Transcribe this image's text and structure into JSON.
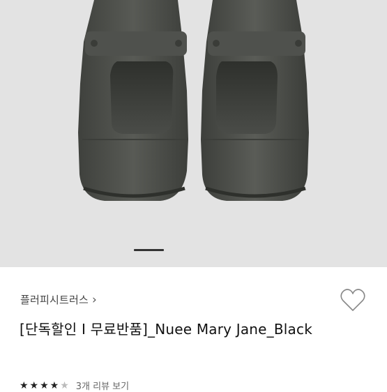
{
  "product": {
    "brand": "플러피시트러스",
    "brand_chevron": "›",
    "title": "[단독할인 I 무료반품]_Nuee Mary Jane_Black",
    "rating": {
      "stars_filled": 4,
      "stars_total": 5,
      "review_text": "3개 리뷰 보기"
    }
  },
  "gallery": {
    "image": "shoe-photo",
    "active_index": 0
  },
  "icons": {
    "wishlist": "heart-outline-icon",
    "brand": "chevron-right-icon"
  },
  "colors": {
    "background_image": "#e3e3e3",
    "shoe": "#4a4c48"
  }
}
